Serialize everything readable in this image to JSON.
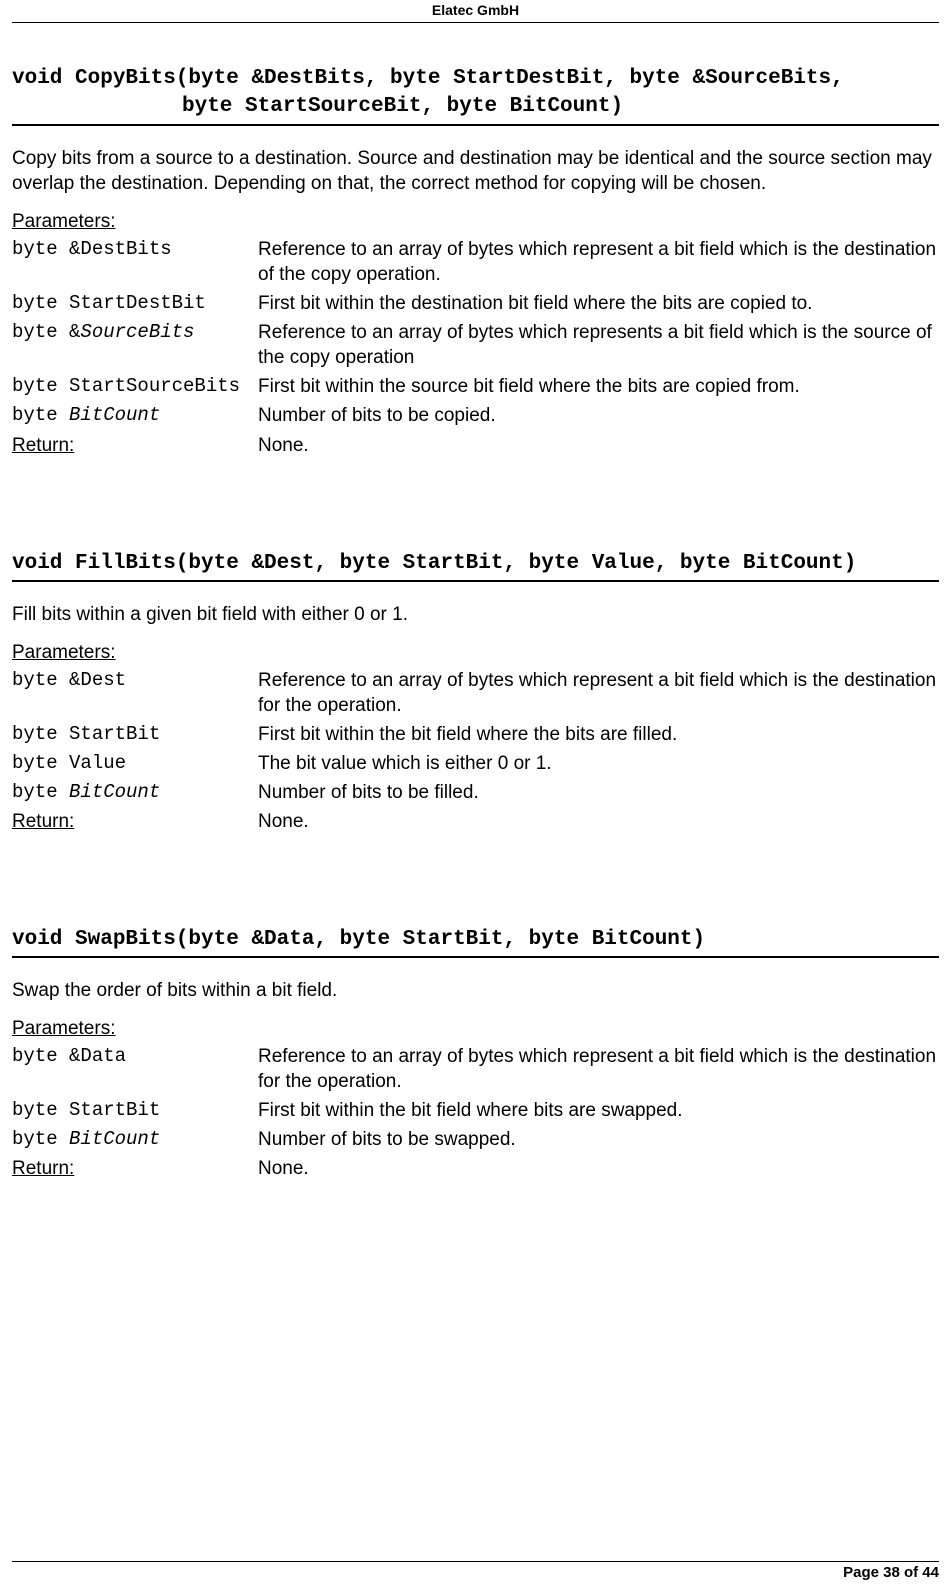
{
  "header": "Elatec GmbH",
  "footer": "Page 38 of 44",
  "labels": {
    "parameters": "Parameters:",
    "return": "Return:"
  },
  "sections": [
    {
      "signature_line1": "void CopyBits(byte &DestBits, byte StartDestBit, byte &SourceBits,",
      "signature_line2": "byte StartSourceBit, byte BitCount)",
      "description": "Copy bits from a source to a destination. Source and destination may be identical and the source section may overlap the destination. Depending on that, the correct method for copying will be chosen.",
      "params": [
        {
          "name_plain": "byte &DestBits",
          "name_ital": "",
          "desc": "Reference to an array of bytes which represent a bit field which is the destination of the copy operation."
        },
        {
          "name_plain": "byte StartDestBit",
          "name_ital": "",
          "desc": "First bit within the destination bit field where the bits are copied to."
        },
        {
          "name_plain": "byte &",
          "name_ital": "SourceBits",
          "desc": "Reference to an array of bytes which represents a bit field which is the source of the copy operation"
        },
        {
          "name_plain": "byte StartSourceBits",
          "name_ital": "",
          "desc": "First bit within the source bit field where the bits are copied from."
        },
        {
          "name_plain": "byte ",
          "name_ital": "BitCount",
          "desc": "Number of bits to be copied."
        }
      ],
      "return_value": "None."
    },
    {
      "signature_line1": "void FillBits(byte &Dest, byte StartBit, byte Value, byte BitCount)",
      "signature_line2": "",
      "description": "Fill bits within a given bit field with either 0 or 1.",
      "params": [
        {
          "name_plain": "byte &Dest",
          "name_ital": "",
          "desc": "Reference to an array of bytes which represent a bit field which is the destination for the operation."
        },
        {
          "name_plain": "byte StartBit",
          "name_ital": "",
          "desc": "First bit within the bit field where the bits are filled."
        },
        {
          "name_plain": "byte Value",
          "name_ital": "",
          "desc": "The bit value which is either 0 or 1."
        },
        {
          "name_plain": "byte ",
          "name_ital": "BitCount",
          "desc": "Number of bits to be filled."
        }
      ],
      "return_value": "None."
    },
    {
      "signature_line1": "void SwapBits(byte &Data, byte StartBit, byte BitCount)",
      "signature_line2": "",
      "description": "Swap the order of bits within a bit field.",
      "params": [
        {
          "name_plain": "byte &Data",
          "name_ital": "",
          "desc": "Reference to an array of bytes which represent a bit field which is the destination for the operation."
        },
        {
          "name_plain": "byte StartBit",
          "name_ital": "",
          "desc": "First bit within the bit field where bits are swapped."
        },
        {
          "name_plain": "byte ",
          "name_ital": "BitCount",
          "desc": "Number of bits to be swapped."
        }
      ],
      "return_value": "None."
    }
  ]
}
